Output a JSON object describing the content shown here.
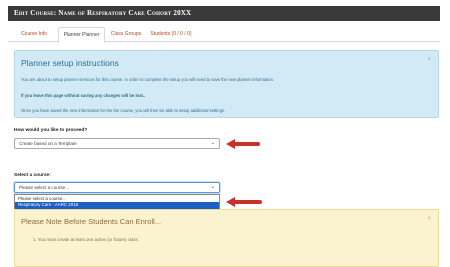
{
  "header": {
    "title": "Edit Course: Name of Respiratory Care Cohort 20XX"
  },
  "tabs": [
    {
      "label": "Course Info",
      "active": false
    },
    {
      "label": "Planner Planner",
      "active": true
    },
    {
      "label": "Class Groups",
      "active": false
    },
    {
      "label": "Students (0 / 0 / 0)",
      "active": false
    }
  ],
  "info_alert": {
    "title": "Planner setup instructions",
    "line1": "You are about to setup planner services for this course. In order to complete the setup you will need to save the new planner information.",
    "line2": "If you leave this page without saving any changes will be lost..",
    "line3": "Once you have saved the new information for the the course, you will then be able to setup additional settings.",
    "close": "×"
  },
  "proceed": {
    "label": "How would you like to proceed?",
    "value": "Create based on a Template"
  },
  "course": {
    "label": "Select a course:",
    "value": "Please select a course...",
    "options": [
      "Please select a course...",
      "Respiratory Care - AARC 2016"
    ],
    "selected_index": 1
  },
  "warning": {
    "title": "Please Note Before Students Can Enroll...",
    "item": "1.  You must create at least one active (or future) class.",
    "close": "×"
  },
  "colors": {
    "annotation_arrow": "#c7332b",
    "header_bg": "#3a3a3a"
  }
}
